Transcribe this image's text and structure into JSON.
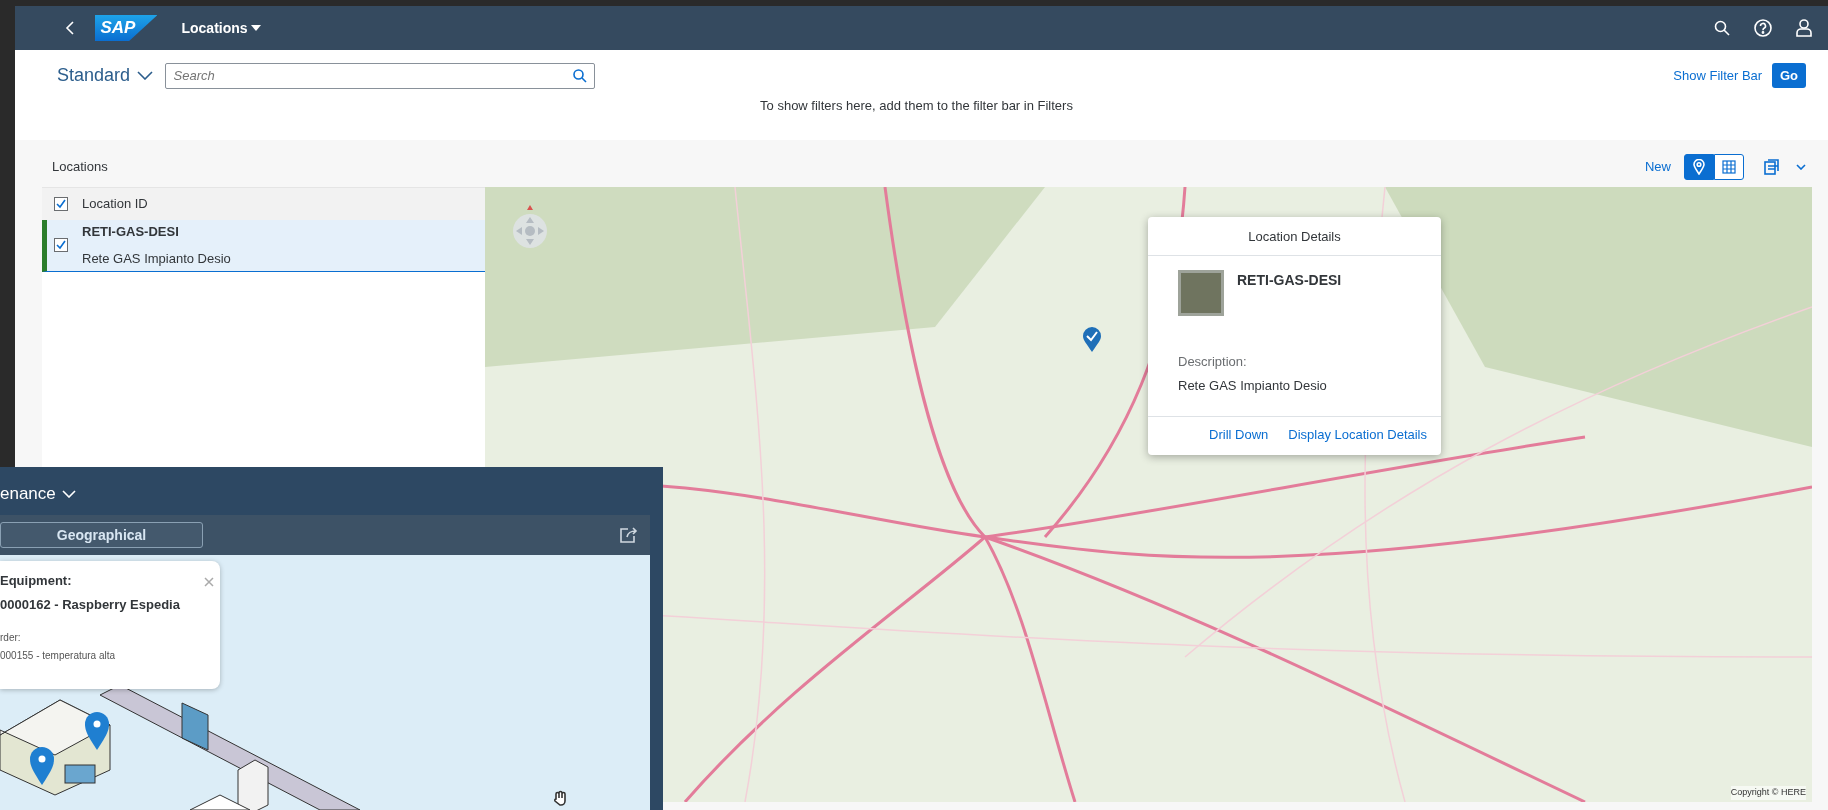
{
  "shell": {
    "logo": "SAP",
    "title": "Locations"
  },
  "filter_bar": {
    "variant": "Standard",
    "search": {
      "placeholder": "Search"
    },
    "show_filter_bar": "Show Filter Bar",
    "go": "Go",
    "hint": "To show filters here, add them to the filter bar in Filters"
  },
  "locations": {
    "title": "Locations",
    "new": "New",
    "views": [
      {
        "kind": "map",
        "selected": true
      },
      {
        "kind": "table",
        "selected": false
      }
    ],
    "header": {
      "label": "Location ID",
      "checked": true
    },
    "rows": [
      {
        "id": "RETI-GAS-DESI",
        "description": "Rete GAS Impianto Desio",
        "checked": true,
        "selected": true
      }
    ]
  },
  "map": {
    "attribution": "Copyright © HERE"
  },
  "popover": {
    "title": "Location Details",
    "name": "RETI-GAS-DESI",
    "description_label": "Description:",
    "description": "Rete GAS Impianto Desio",
    "actions": [
      "Drill Down",
      "Display Location Details"
    ]
  },
  "overlay_window": {
    "title": "enance",
    "tab": "Geographical",
    "tooltip": {
      "equipment_label": "Equipment:",
      "equipment": "0000162 - Raspberry Espedia",
      "order_label": "rder:",
      "order": "000155 - temperatura alta"
    }
  }
}
